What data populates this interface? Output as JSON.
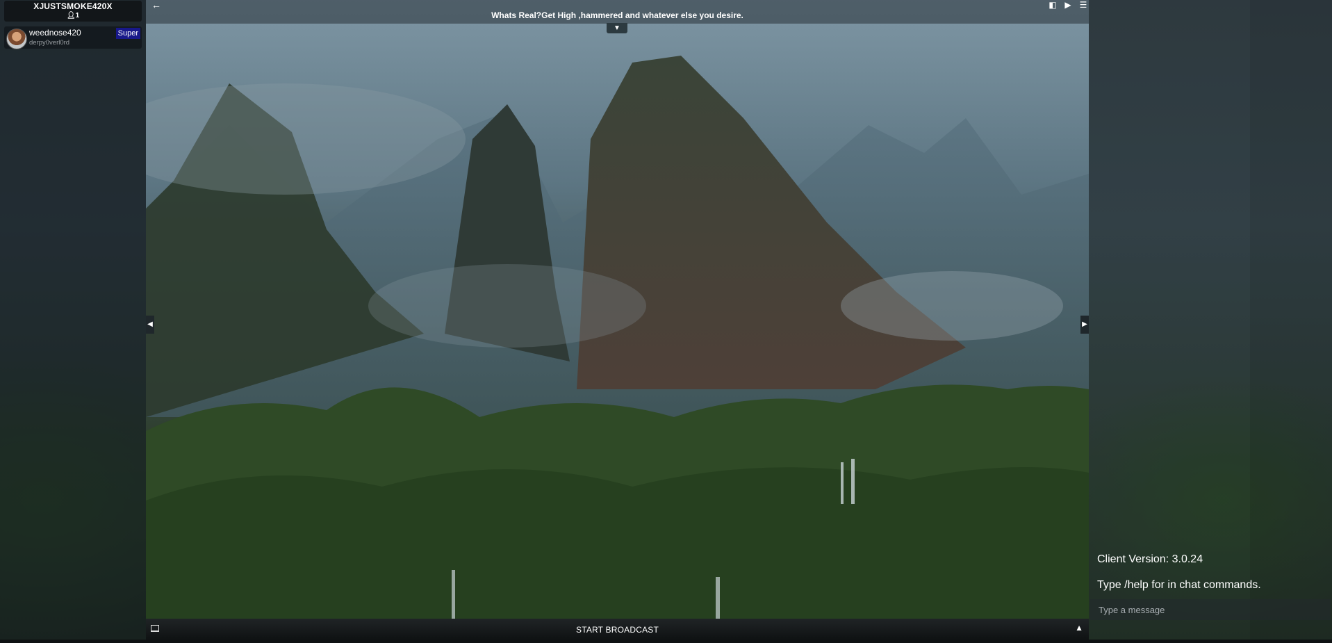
{
  "room": {
    "name": "XJUSTSMOKE420X",
    "viewer_count": "1"
  },
  "users": [
    {
      "name": "weednose420",
      "status": "derpy0verl0rd",
      "role": "Super"
    }
  ],
  "stage": {
    "topic": "Whats Real?Get High ,hammered and whatever else you desire."
  },
  "broadcast": {
    "label": "START BROADCAST"
  },
  "chat": {
    "messages": [
      "Client Version: 3.0.24",
      "Type /help for in chat commands."
    ],
    "input_placeholder": "Type a message"
  },
  "icons": {
    "back": "arrow-left-icon",
    "user_count": "person-icon",
    "tools": [
      "layout-toggle-icon",
      "video-icon",
      "menu-icon"
    ],
    "collapse": "chevron-down-icon",
    "left_toggle": "chevron-left-icon",
    "right_toggle": "chevron-right-icon",
    "monitor": "monitor-icon",
    "expand": "chevron-up-icon"
  },
  "colors": {
    "role_badge": "#18188a",
    "header_bg": "#121619"
  }
}
